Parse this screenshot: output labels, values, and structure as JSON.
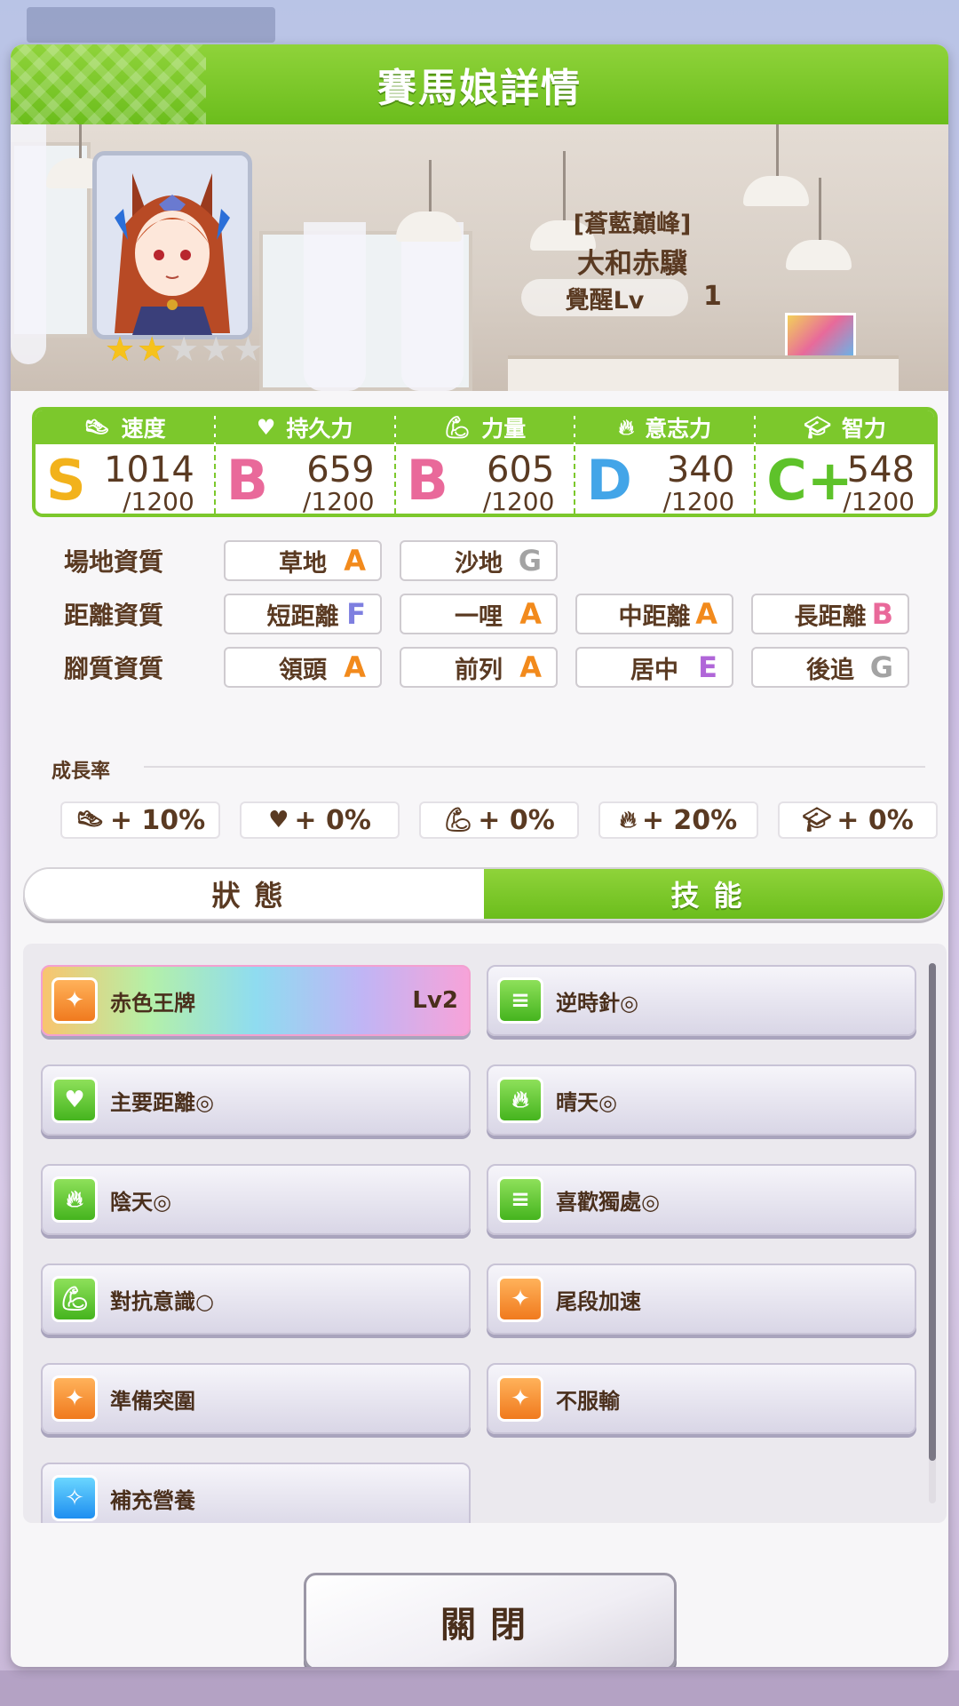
{
  "header": {
    "title": "賽馬娘詳情"
  },
  "character": {
    "title": "[蒼藍巔峰]",
    "name": "大和赤驥",
    "awakening_label": "覺醒Lv",
    "awakening_level": "1",
    "rarity_stars": 2,
    "max_stars": 5
  },
  "stats": [
    {
      "label": "速度",
      "icon": "shoe-icon",
      "grade": "S",
      "value": "1014",
      "max": "/1200",
      "grade_color": "#f2b21c"
    },
    {
      "label": "持久力",
      "icon": "heart-icon",
      "grade": "B",
      "value": "659",
      "max": "/1200",
      "grade_color": "#e9699a"
    },
    {
      "label": "力量",
      "icon": "muscle-icon",
      "grade": "B",
      "value": "605",
      "max": "/1200",
      "grade_color": "#e9699a"
    },
    {
      "label": "意志力",
      "icon": "flame-icon",
      "grade": "D",
      "value": "340",
      "max": "/1200",
      "grade_color": "#43a5e8"
    },
    {
      "label": "智力",
      "icon": "graduation-cap-icon",
      "grade": "C+",
      "value": "548",
      "max": "/1200",
      "grade_color": "#5ec22a"
    }
  ],
  "aptitudes": {
    "track": {
      "label": "場地資質",
      "items": [
        {
          "name": "草地",
          "grade": "A"
        },
        {
          "name": "沙地",
          "grade": "G"
        }
      ]
    },
    "distance": {
      "label": "距離資質",
      "items": [
        {
          "name": "短距離",
          "grade": "F"
        },
        {
          "name": "一哩",
          "grade": "A"
        },
        {
          "name": "中距離",
          "grade": "A"
        },
        {
          "name": "長距離",
          "grade": "B"
        }
      ]
    },
    "style": {
      "label": "腳質資質",
      "items": [
        {
          "name": "領頭",
          "grade": "A"
        },
        {
          "name": "前列",
          "grade": "A"
        },
        {
          "name": "居中",
          "grade": "E"
        },
        {
          "name": "後追",
          "grade": "G"
        }
      ]
    }
  },
  "growth": {
    "label": "成長率",
    "items": [
      {
        "icon": "shoe-icon",
        "value": "+ 10%"
      },
      {
        "icon": "heart-icon",
        "value": "+ 0%"
      },
      {
        "icon": "muscle-icon",
        "value": "+ 0%"
      },
      {
        "icon": "flame-icon",
        "value": "+ 20%"
      },
      {
        "icon": "graduation-cap-icon",
        "value": "+ 0%"
      }
    ]
  },
  "tabs": {
    "status": "狀態",
    "skills": "技能",
    "active": "skills"
  },
  "skills": [
    {
      "name": "赤色王牌",
      "level": "Lv2",
      "icon": "orange",
      "rainbow": true
    },
    {
      "name": "逆時針◎",
      "icon": "green"
    },
    {
      "name": "主要距離◎",
      "icon": "green"
    },
    {
      "name": "晴天◎",
      "icon": "green"
    },
    {
      "name": "陰天◎",
      "icon": "green"
    },
    {
      "name": "喜歡獨處◎",
      "icon": "green"
    },
    {
      "name": "對抗意識○",
      "icon": "green"
    },
    {
      "name": "尾段加速",
      "icon": "orange"
    },
    {
      "name": "準備突圍",
      "icon": "orange"
    },
    {
      "name": "不服輸",
      "icon": "orange"
    },
    {
      "name": "補充營養",
      "icon": "blue"
    }
  ],
  "close_button": "關閉"
}
